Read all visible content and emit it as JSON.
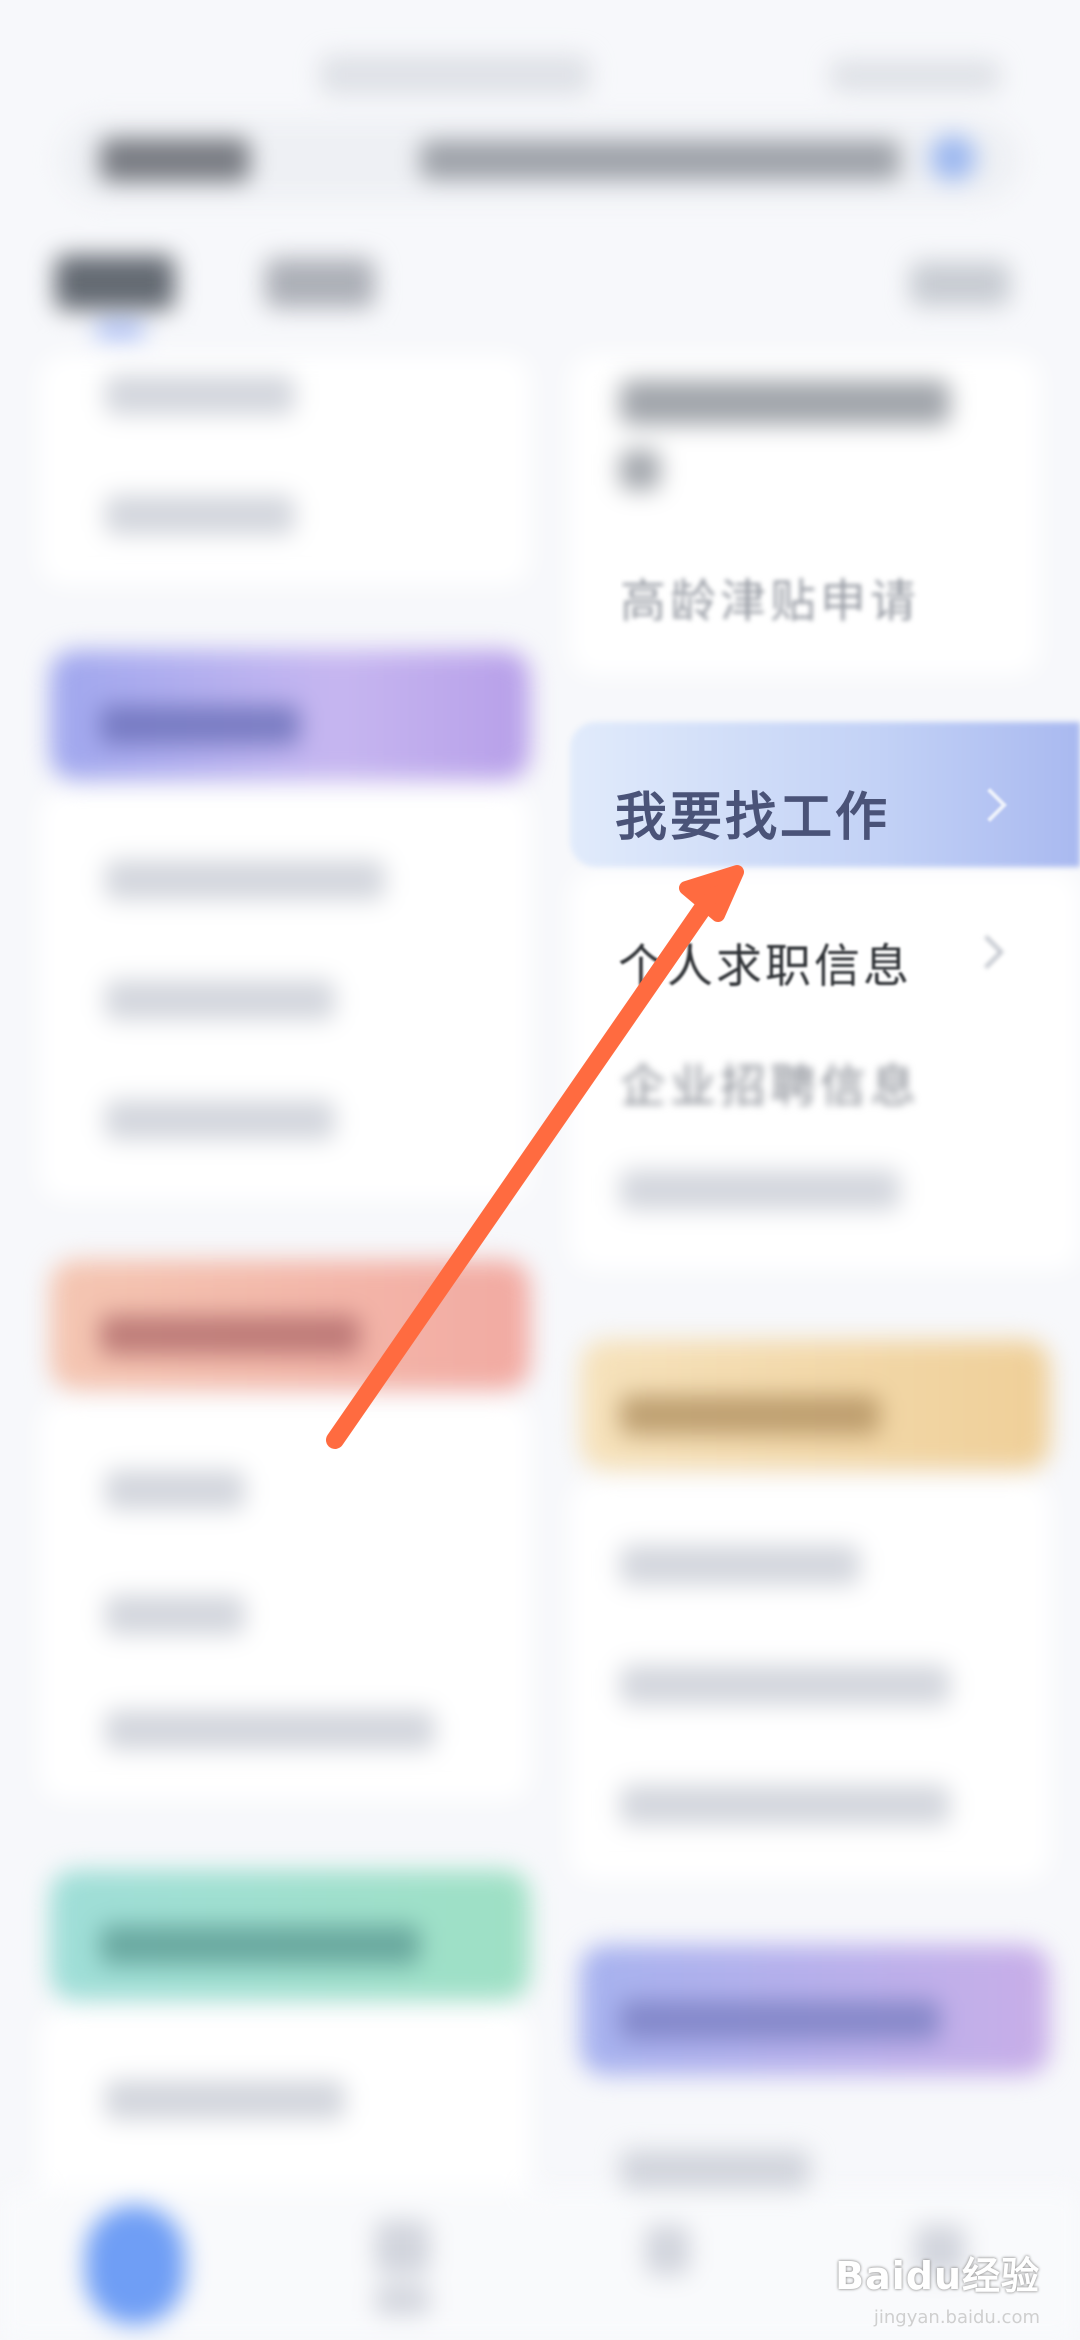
{
  "right_panel": {
    "visible_item_partial": "高龄津贴申请",
    "highlighted_item": "我要找工作",
    "item_personal": "个人求职信息",
    "item_enterprise_partial": "企业招聘信息"
  },
  "watermark": {
    "brand": "Baidu经验",
    "sub": "jingyan.baidu.com"
  },
  "colors": {
    "arrow": "#ff6b40",
    "group_purple": "#bfb0ee",
    "group_salmon": "#f4b1a8",
    "group_green": "#a3e0cb",
    "group_yellow": "#f3dcaa",
    "highlight": "#c3d2f6"
  }
}
